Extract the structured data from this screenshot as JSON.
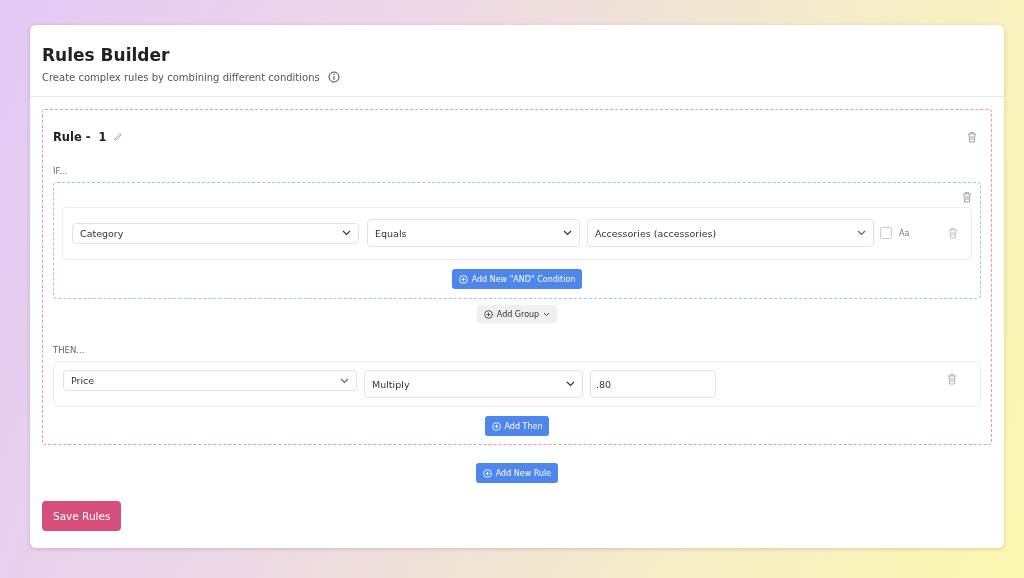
{
  "header": {
    "title": "Rules Builder",
    "subtitle": "Create complex rules by combining different conditions"
  },
  "rules": [
    {
      "label": "Rule -",
      "number": "1",
      "if_label": "IF...",
      "groups": [
        {
          "conditions": [
            {
              "field": "Category",
              "operator": "Equals",
              "value": "Accessories (accessories)",
              "case_sensitive": {
                "checked": false,
                "label": "Aa"
              }
            }
          ],
          "add_condition": "Add New \"AND\" Condition"
        }
      ],
      "add_group": "Add Group",
      "then_label": "THEN...",
      "actions": [
        {
          "field": "Price",
          "operation": "Multiply",
          "value": ".80"
        }
      ],
      "add_then": "Add Then"
    }
  ],
  "add_rule": "Add New Rule",
  "save": "Save Rules"
}
